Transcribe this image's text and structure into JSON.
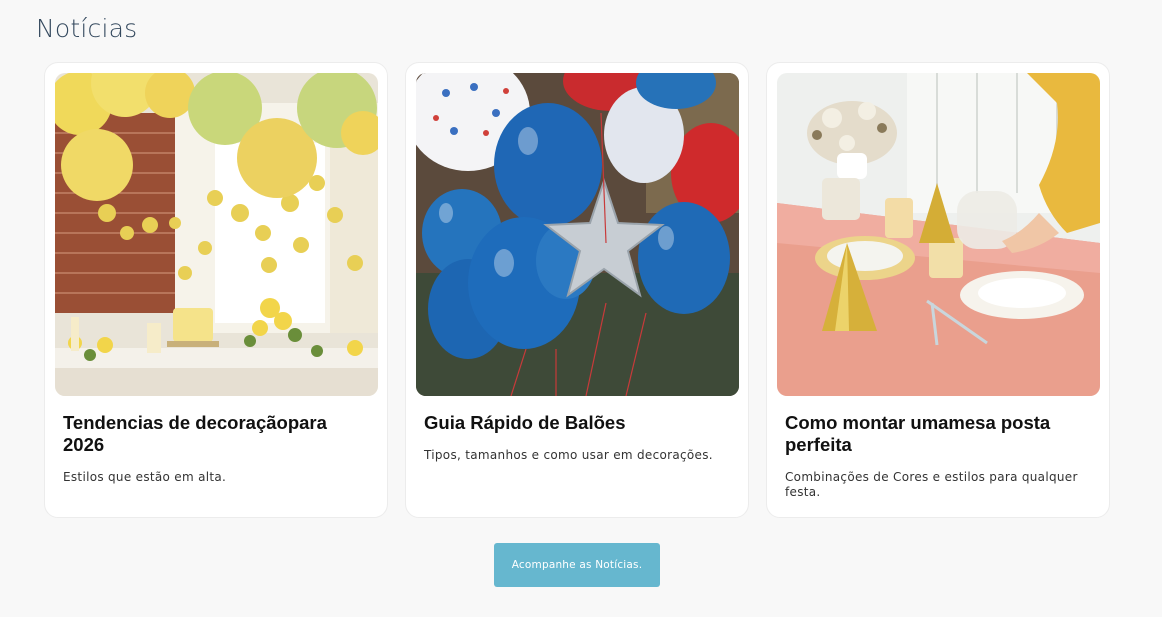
{
  "section": {
    "title": "Notícias"
  },
  "cards": [
    {
      "title": "Tendencias de decoraçãopara 2026",
      "description": "Estilos que estão em alta.",
      "image": "yellow-lanterns-party-photo"
    },
    {
      "title": "Guia Rápido de Balões",
      "description": "Tipos, tamanhos e como usar em decorações.",
      "image": "blue-balloons-photo"
    },
    {
      "title": "Como montar umamesa posta perfeita",
      "description": "Combinações de Cores e estilos para qualquer festa.",
      "image": "pink-party-table-photo"
    }
  ],
  "cta": {
    "label": "Acompanhe as Notícias."
  },
  "colors": {
    "accent": "#66b7cf",
    "title": "#34495e",
    "background": "#f8f8f8"
  }
}
